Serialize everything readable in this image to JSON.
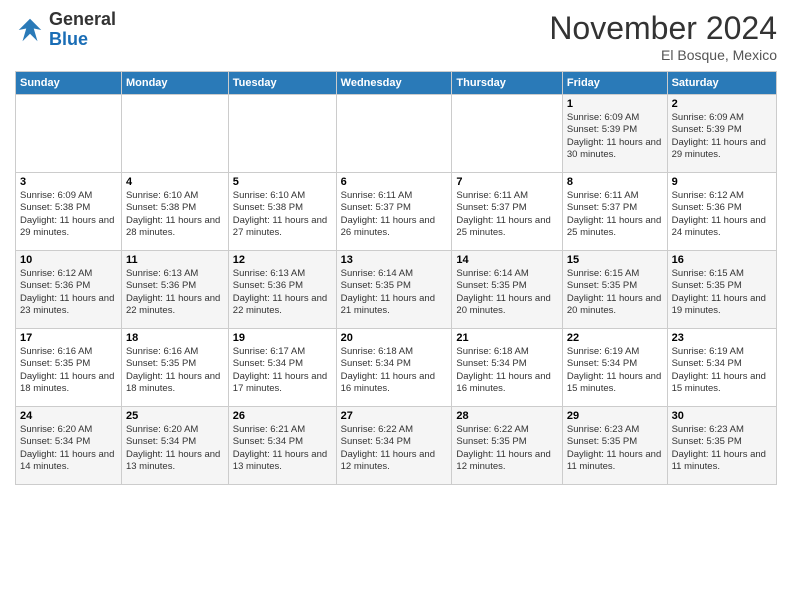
{
  "logo": {
    "line1": "General",
    "line2": "Blue"
  },
  "title": "November 2024",
  "location": "El Bosque, Mexico",
  "days_of_week": [
    "Sunday",
    "Monday",
    "Tuesday",
    "Wednesday",
    "Thursday",
    "Friday",
    "Saturday"
  ],
  "weeks": [
    [
      {
        "day": "",
        "info": ""
      },
      {
        "day": "",
        "info": ""
      },
      {
        "day": "",
        "info": ""
      },
      {
        "day": "",
        "info": ""
      },
      {
        "day": "",
        "info": ""
      },
      {
        "day": "1",
        "info": "Sunrise: 6:09 AM\nSunset: 5:39 PM\nDaylight: 11 hours and 30 minutes."
      },
      {
        "day": "2",
        "info": "Sunrise: 6:09 AM\nSunset: 5:39 PM\nDaylight: 11 hours and 29 minutes."
      }
    ],
    [
      {
        "day": "3",
        "info": "Sunrise: 6:09 AM\nSunset: 5:38 PM\nDaylight: 11 hours and 29 minutes."
      },
      {
        "day": "4",
        "info": "Sunrise: 6:10 AM\nSunset: 5:38 PM\nDaylight: 11 hours and 28 minutes."
      },
      {
        "day": "5",
        "info": "Sunrise: 6:10 AM\nSunset: 5:38 PM\nDaylight: 11 hours and 27 minutes."
      },
      {
        "day": "6",
        "info": "Sunrise: 6:11 AM\nSunset: 5:37 PM\nDaylight: 11 hours and 26 minutes."
      },
      {
        "day": "7",
        "info": "Sunrise: 6:11 AM\nSunset: 5:37 PM\nDaylight: 11 hours and 25 minutes."
      },
      {
        "day": "8",
        "info": "Sunrise: 6:11 AM\nSunset: 5:37 PM\nDaylight: 11 hours and 25 minutes."
      },
      {
        "day": "9",
        "info": "Sunrise: 6:12 AM\nSunset: 5:36 PM\nDaylight: 11 hours and 24 minutes."
      }
    ],
    [
      {
        "day": "10",
        "info": "Sunrise: 6:12 AM\nSunset: 5:36 PM\nDaylight: 11 hours and 23 minutes."
      },
      {
        "day": "11",
        "info": "Sunrise: 6:13 AM\nSunset: 5:36 PM\nDaylight: 11 hours and 22 minutes."
      },
      {
        "day": "12",
        "info": "Sunrise: 6:13 AM\nSunset: 5:36 PM\nDaylight: 11 hours and 22 minutes."
      },
      {
        "day": "13",
        "info": "Sunrise: 6:14 AM\nSunset: 5:35 PM\nDaylight: 11 hours and 21 minutes."
      },
      {
        "day": "14",
        "info": "Sunrise: 6:14 AM\nSunset: 5:35 PM\nDaylight: 11 hours and 20 minutes."
      },
      {
        "day": "15",
        "info": "Sunrise: 6:15 AM\nSunset: 5:35 PM\nDaylight: 11 hours and 20 minutes."
      },
      {
        "day": "16",
        "info": "Sunrise: 6:15 AM\nSunset: 5:35 PM\nDaylight: 11 hours and 19 minutes."
      }
    ],
    [
      {
        "day": "17",
        "info": "Sunrise: 6:16 AM\nSunset: 5:35 PM\nDaylight: 11 hours and 18 minutes."
      },
      {
        "day": "18",
        "info": "Sunrise: 6:16 AM\nSunset: 5:35 PM\nDaylight: 11 hours and 18 minutes."
      },
      {
        "day": "19",
        "info": "Sunrise: 6:17 AM\nSunset: 5:34 PM\nDaylight: 11 hours and 17 minutes."
      },
      {
        "day": "20",
        "info": "Sunrise: 6:18 AM\nSunset: 5:34 PM\nDaylight: 11 hours and 16 minutes."
      },
      {
        "day": "21",
        "info": "Sunrise: 6:18 AM\nSunset: 5:34 PM\nDaylight: 11 hours and 16 minutes."
      },
      {
        "day": "22",
        "info": "Sunrise: 6:19 AM\nSunset: 5:34 PM\nDaylight: 11 hours and 15 minutes."
      },
      {
        "day": "23",
        "info": "Sunrise: 6:19 AM\nSunset: 5:34 PM\nDaylight: 11 hours and 15 minutes."
      }
    ],
    [
      {
        "day": "24",
        "info": "Sunrise: 6:20 AM\nSunset: 5:34 PM\nDaylight: 11 hours and 14 minutes."
      },
      {
        "day": "25",
        "info": "Sunrise: 6:20 AM\nSunset: 5:34 PM\nDaylight: 11 hours and 13 minutes."
      },
      {
        "day": "26",
        "info": "Sunrise: 6:21 AM\nSunset: 5:34 PM\nDaylight: 11 hours and 13 minutes."
      },
      {
        "day": "27",
        "info": "Sunrise: 6:22 AM\nSunset: 5:34 PM\nDaylight: 11 hours and 12 minutes."
      },
      {
        "day": "28",
        "info": "Sunrise: 6:22 AM\nSunset: 5:35 PM\nDaylight: 11 hours and 12 minutes."
      },
      {
        "day": "29",
        "info": "Sunrise: 6:23 AM\nSunset: 5:35 PM\nDaylight: 11 hours and 11 minutes."
      },
      {
        "day": "30",
        "info": "Sunrise: 6:23 AM\nSunset: 5:35 PM\nDaylight: 11 hours and 11 minutes."
      }
    ]
  ]
}
